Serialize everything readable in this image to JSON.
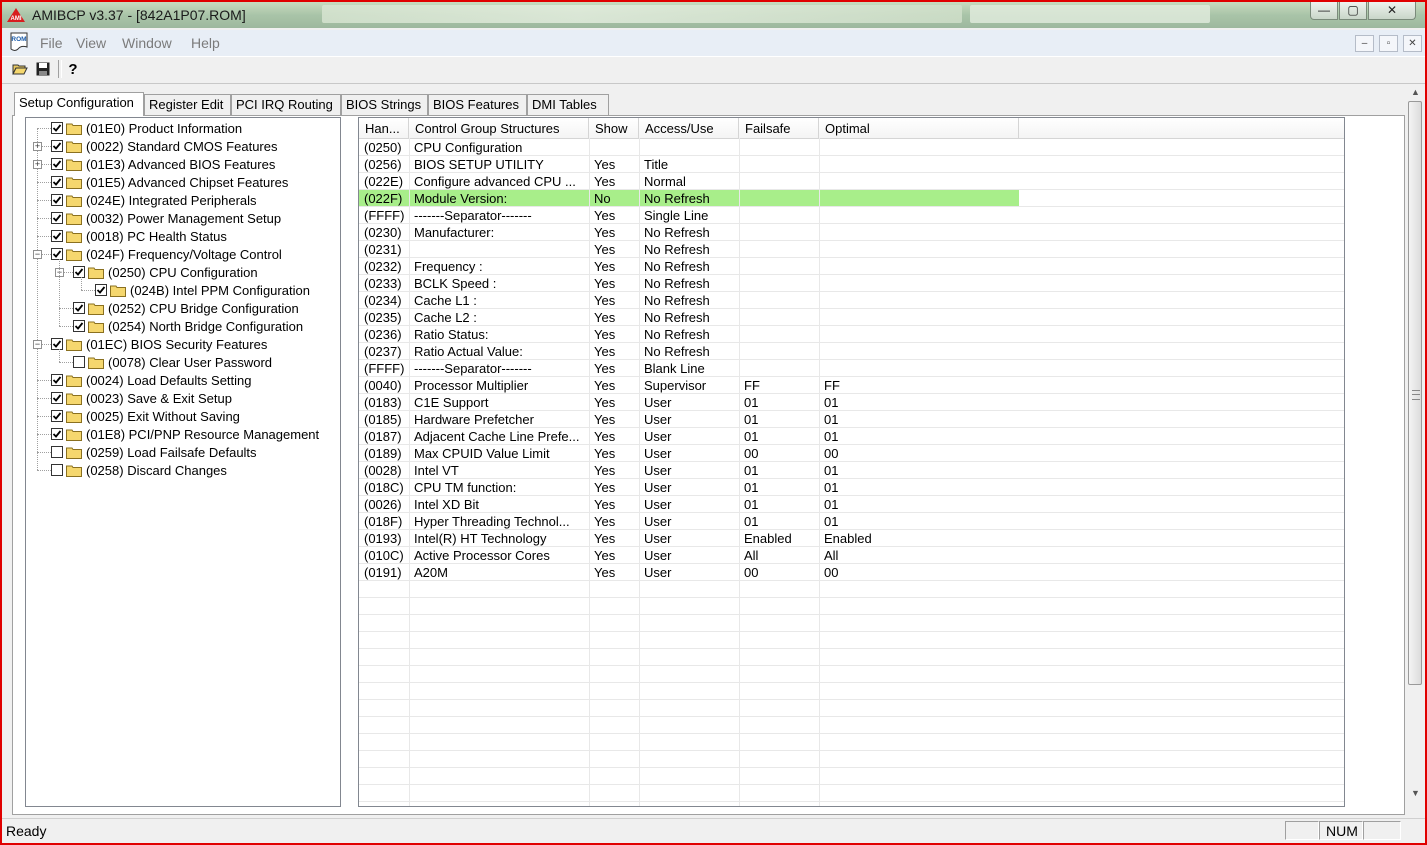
{
  "window": {
    "title": "AMIBCP v3.37 - [842A1P07.ROM]",
    "min_glyph": "—",
    "max_glyph": "▢",
    "close_glyph": "✕"
  },
  "menu": [
    "File",
    "View",
    "Window",
    "Help"
  ],
  "mdi_buttons": [
    "–",
    "▫",
    "✕"
  ],
  "toolbar": [
    {
      "icon": "open-folder-icon"
    },
    {
      "icon": "save-disk-icon"
    },
    {
      "icon": "help-icon",
      "glyph": "?"
    }
  ],
  "rom_icon_label": "ROM",
  "tabs": [
    "Setup Configuration",
    "Register Edit",
    "PCI IRQ Routing",
    "BIOS Strings",
    "BIOS Features",
    "DMI Tables"
  ],
  "tree": [
    {
      "label": "(01E0) Product Information",
      "level": 0,
      "checked": true,
      "expander": ""
    },
    {
      "label": "(0022) Standard CMOS Features",
      "level": 0,
      "checked": true,
      "expander": "+"
    },
    {
      "label": "(01E3) Advanced BIOS Features",
      "level": 0,
      "checked": true,
      "expander": "+"
    },
    {
      "label": "(01E5) Advanced Chipset Features",
      "level": 0,
      "checked": true,
      "expander": ""
    },
    {
      "label": "(024E) Integrated Peripherals",
      "level": 0,
      "checked": true,
      "expander": ""
    },
    {
      "label": "(0032) Power Management Setup",
      "level": 0,
      "checked": true,
      "expander": ""
    },
    {
      "label": "(0018) PC Health Status",
      "level": 0,
      "checked": true,
      "expander": ""
    },
    {
      "label": "(024F) Frequency/Voltage Control",
      "level": 0,
      "checked": true,
      "expander": "−"
    },
    {
      "label": "(0250) CPU Configuration",
      "level": 1,
      "checked": true,
      "expander": "−"
    },
    {
      "label": "(024B) Intel PPM Configuration",
      "level": 2,
      "checked": true,
      "expander": ""
    },
    {
      "label": "(0252) CPU Bridge Configuration",
      "level": 1,
      "checked": true,
      "expander": ""
    },
    {
      "label": "(0254) North Bridge Configuration",
      "level": 1,
      "checked": true,
      "expander": ""
    },
    {
      "label": "(01EC) BIOS Security Features",
      "level": 0,
      "checked": true,
      "expander": "−"
    },
    {
      "label": "(0078) Clear User Password",
      "level": 1,
      "checked": false,
      "expander": ""
    },
    {
      "label": "(0024) Load Defaults Setting",
      "level": 0,
      "checked": true,
      "expander": ""
    },
    {
      "label": "(0023) Save & Exit Setup",
      "level": 0,
      "checked": true,
      "expander": ""
    },
    {
      "label": "(0025) Exit Without Saving",
      "level": 0,
      "checked": true,
      "expander": ""
    },
    {
      "label": "(01E8) PCI/PNP Resource Management",
      "level": 0,
      "checked": true,
      "expander": ""
    },
    {
      "label": "(0259) Load Failsafe Defaults",
      "level": 0,
      "checked": false,
      "expander": ""
    },
    {
      "label": "(0258) Discard Changes",
      "level": 0,
      "checked": false,
      "expander": ""
    }
  ],
  "list": {
    "columns": [
      "Han...",
      "Control Group Structures",
      "Show",
      "Access/Use",
      "Failsafe",
      "Optimal"
    ],
    "rows": [
      [
        "(0250)",
        "CPU Configuration",
        "",
        "",
        "",
        ""
      ],
      [
        "(0256)",
        "BIOS SETUP UTILITY",
        "Yes",
        "Title",
        "",
        ""
      ],
      [
        "(022E)",
        "Configure advanced CPU ...",
        "Yes",
        "Normal",
        "",
        ""
      ],
      [
        "(022F)",
        "Module Version:",
        "No",
        "No Refresh",
        "",
        ""
      ],
      [
        "(FFFF)",
        "-------Separator-------",
        "Yes",
        "Single Line",
        "",
        ""
      ],
      [
        "(0230)",
        "Manufacturer:",
        "Yes",
        "No Refresh",
        "",
        ""
      ],
      [
        "(0231)",
        "",
        "Yes",
        "No Refresh",
        "",
        ""
      ],
      [
        "(0232)",
        "Frequency   :",
        "Yes",
        "No Refresh",
        "",
        ""
      ],
      [
        "(0233)",
        "BCLK Speed  :",
        "Yes",
        "No Refresh",
        "",
        ""
      ],
      [
        "(0234)",
        "Cache L1    :",
        "Yes",
        "No Refresh",
        "",
        ""
      ],
      [
        "(0235)",
        "Cache L2    :",
        "Yes",
        "No Refresh",
        "",
        ""
      ],
      [
        "(0236)",
        "Ratio Status:",
        "Yes",
        "No Refresh",
        "",
        ""
      ],
      [
        "(0237)",
        "Ratio Actual Value:",
        "Yes",
        "No Refresh",
        "",
        ""
      ],
      [
        "(FFFF)",
        "-------Separator-------",
        "Yes",
        "Blank Line",
        "",
        ""
      ],
      [
        "(0040)",
        "Processor Multiplier",
        "Yes",
        "Supervisor",
        "FF",
        "FF"
      ],
      [
        "(0183)",
        "C1E Support",
        "Yes",
        "User",
        "01",
        "01"
      ],
      [
        "(0185)",
        "Hardware Prefetcher",
        "Yes",
        "User",
        "01",
        "01"
      ],
      [
        "(0187)",
        "Adjacent Cache Line Prefe...",
        "Yes",
        "User",
        "01",
        "01"
      ],
      [
        "(0189)",
        "Max CPUID Value Limit",
        "Yes",
        "User",
        "00",
        "00"
      ],
      [
        "(0028)",
        "Intel VT",
        "Yes",
        "User",
        "01",
        "01"
      ],
      [
        "(018C)",
        "CPU TM function:",
        "Yes",
        "User",
        "01",
        "01"
      ],
      [
        "(0026)",
        "Intel XD Bit",
        "Yes",
        "User",
        "01",
        "01"
      ],
      [
        "(018F)",
        "Hyper Threading Technol...",
        "Yes",
        "User",
        "01",
        "01"
      ],
      [
        "(0193)",
        "Intel(R) HT Technology",
        "Yes",
        "User",
        "Enabled",
        "Enabled"
      ],
      [
        "(010C)",
        "Active Processor Cores",
        "Yes",
        "User",
        "All",
        "All"
      ],
      [
        "(0191)",
        "A20M",
        "Yes",
        "User",
        "00",
        "00"
      ]
    ],
    "selected_row": 3,
    "selected_color": "#a8ee8a"
  },
  "status": {
    "text": "Ready",
    "panes": [
      "",
      "NUM",
      ""
    ]
  },
  "colors": {
    "window_border": "#e00000",
    "title_bar": "#a9c4a8",
    "folder": "#f5d76e"
  }
}
